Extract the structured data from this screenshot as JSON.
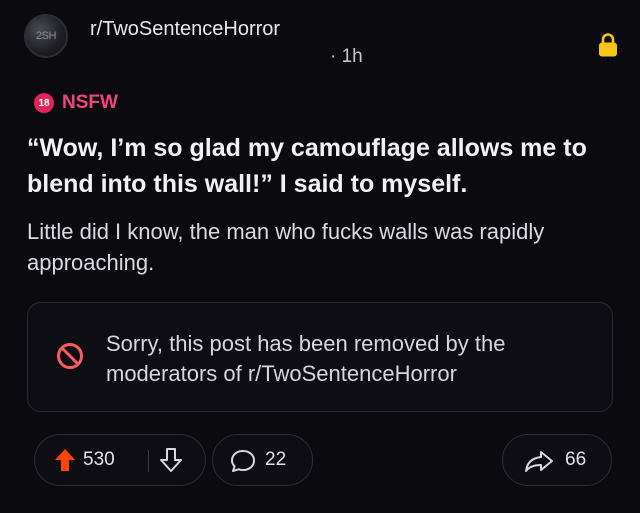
{
  "post": {
    "avatar_text": "2SH",
    "subreddit": "r/TwoSentenceHorror",
    "time": "· 1h",
    "nsfw_badge": "18",
    "nsfw_label": "NSFW",
    "title": "“Wow, I’m so glad my camouflage allows me to blend into this wall!” I said to myself.",
    "body": "Little did I know, the man who fucks walls was rapidly approaching.",
    "removed_notice": "Sorry, this post has been removed by the moderators of r/TwoSentenceHorror"
  },
  "actions": {
    "upvotes": "530",
    "comments": "22",
    "shares": "66"
  },
  "icons": {
    "lock": "lock-icon",
    "removed": "prohibited-icon",
    "upvote": "upvote-arrow-icon",
    "downvote": "downvote-arrow-icon",
    "comment": "comment-bubble-icon",
    "share": "share-arrow-icon"
  },
  "colors": {
    "background": "#0b0a0f",
    "upvote_active": "#ff4500",
    "nsfw": "#e0245e",
    "lock": "#f5c518"
  }
}
